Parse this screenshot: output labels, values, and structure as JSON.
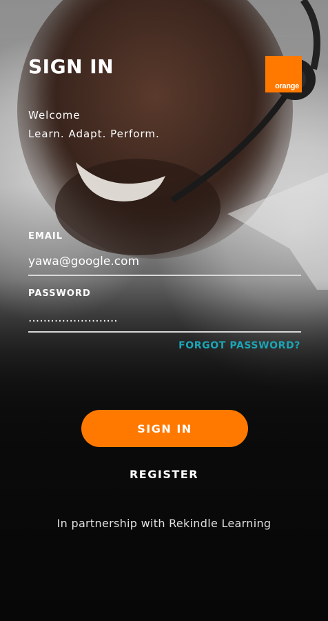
{
  "header": {
    "title": "SIGN IN",
    "logo_text": "orange",
    "brand_color": "#ff7900"
  },
  "welcome": {
    "line1": "Welcome",
    "line2": "Learn. Adapt. Perform."
  },
  "form": {
    "email_label": "EMAIL",
    "email_value": "yawa@google.com",
    "password_label": "PASSWORD",
    "password_value": "........................",
    "forgot_label": "FORGOT PASSWORD?",
    "forgot_color": "#1ba6b6"
  },
  "actions": {
    "sign_in_label": "SIGN IN",
    "register_label": "REGISTER"
  },
  "footer": {
    "partner_text": "In partnership with Rekindle Learning"
  }
}
